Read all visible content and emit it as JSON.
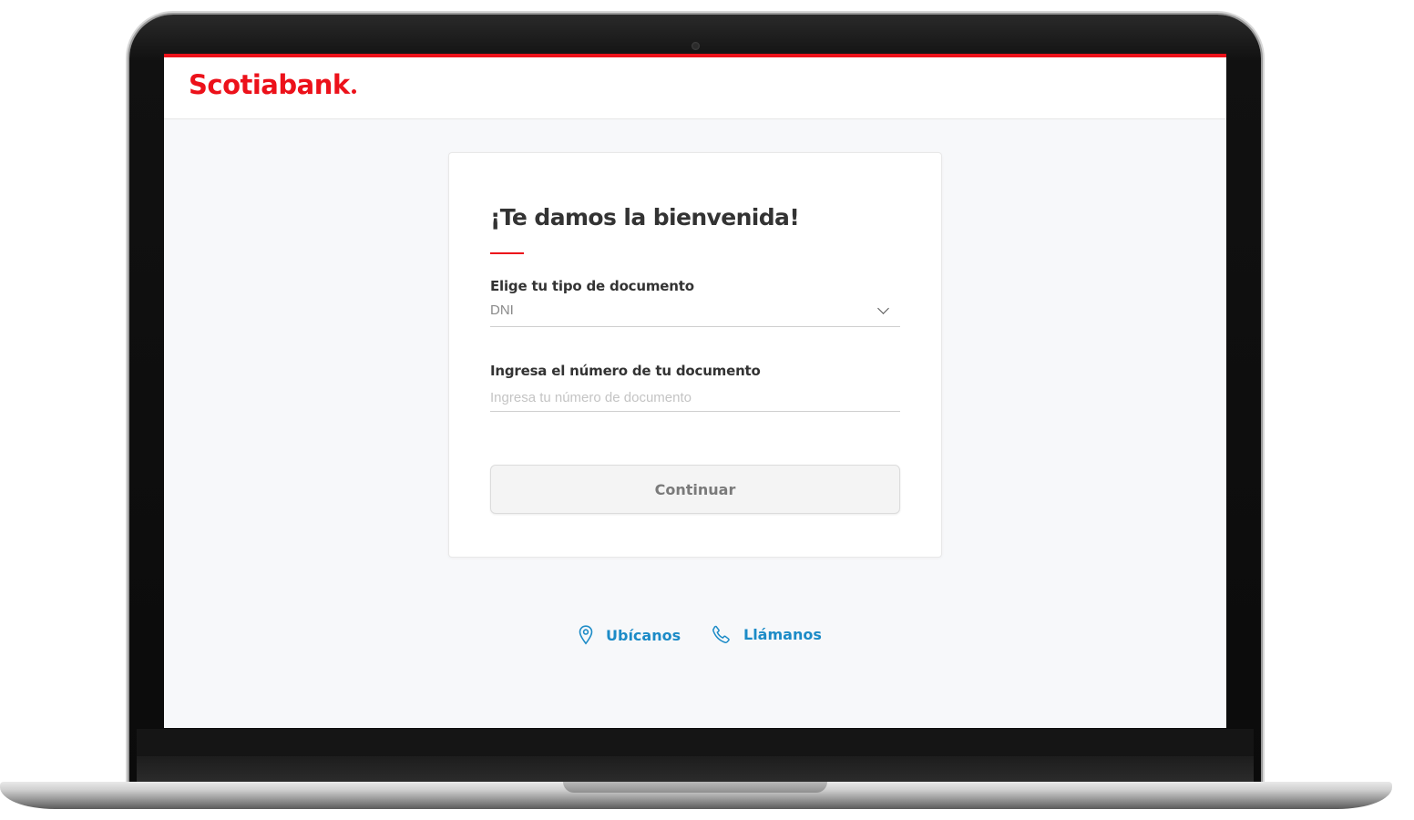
{
  "brand": {
    "name": "Scotiabank",
    "color": "#ec111a"
  },
  "login": {
    "title": "¡Te damos la bienvenida!",
    "document_type": {
      "label": "Elige tu tipo de documento",
      "value": "DNI"
    },
    "document_number": {
      "label": "Ingresa el número de tu documento",
      "placeholder": "Ingresa tu número de documento",
      "value": ""
    },
    "continue_label": "Continuar"
  },
  "footer": {
    "links": [
      {
        "label": "Ubícanos",
        "icon": "location-pin-icon"
      },
      {
        "label": "Llámanos",
        "icon": "phone-icon"
      }
    ],
    "link_color": "#1c8bc7"
  }
}
